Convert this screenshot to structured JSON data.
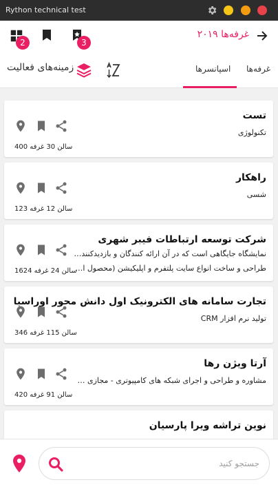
{
  "window": {
    "title": "Rython technical test"
  },
  "colors": {
    "accent": "#e91e63",
    "yellow": "#f5c518",
    "orange": "#f39c12",
    "red": "#e8424a"
  },
  "appbar": {
    "title": "غرفه‌ها ۲۰۱۹",
    "badge_left": "2",
    "badge_mid": "3"
  },
  "tabs": {
    "first": "غرفه‌ها",
    "second": "اسپانسرها",
    "active": "second"
  },
  "filter": {
    "label": "زمینه‌های فعالیت"
  },
  "cards": [
    {
      "name": "تست",
      "lines": [
        "تکنولوژی"
      ],
      "meta": "سالن 30 غرفه 400"
    },
    {
      "name": "راهکار",
      "lines": [
        "شسی"
      ],
      "meta": "سالن 12 غرفه 123"
    },
    {
      "name": "شرکت توسعه ارتباطات فیبر شهری",
      "lines": [
        "نمایشگاه جایگاهی است که در آن ارائه کنندگان و بازدیدکنندگان می‌ت...",
        "طراحی و ساخت انواع سایت پلتفرم و اپلیکیشن (محصول اصلی پلتف..."
      ],
      "meta": "سالن 24 غرفه 1624"
    },
    {
      "name": "تجارت سامانه های الکترونیک اول دانش محور اوراسیا",
      "lines": [
        "تولید نرم افزار CRM"
      ],
      "meta": "سالن 115 غرفه 346"
    },
    {
      "name": "آرتا ویژن رها",
      "lines": [
        "مشاوره و طراحی و اجرای شبکه های کامپیوتری - مجازی سازی سرور ..."
      ],
      "meta": "سالن 91 غرفه 420"
    },
    {
      "name": "نوین تراشه ویرا پارسیان",
      "lines": [],
      "meta": ""
    }
  ],
  "search": {
    "placeholder": "جستجو کنید"
  }
}
